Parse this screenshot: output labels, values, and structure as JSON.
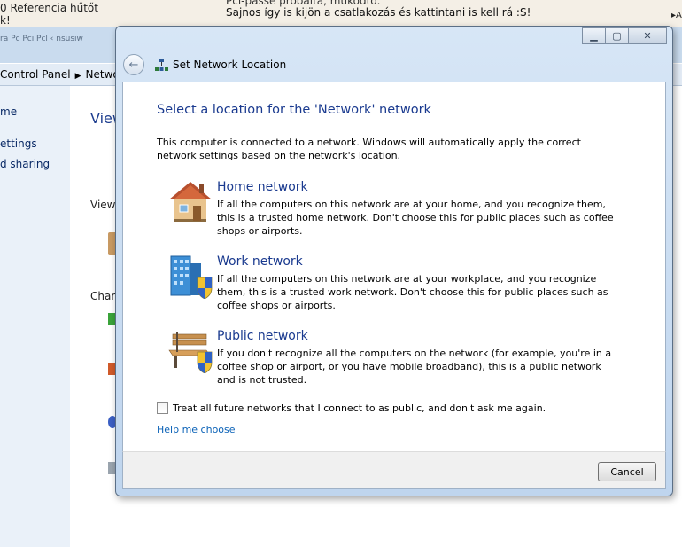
{
  "forum": {
    "left_line1": "0 Referencia hűtőt",
    "left_line2": "k!",
    "post_top": "Pci-passe próbáltá, működtő.",
    "post_line": "Sajnos így is kijön a csatlakozás és kattintani is kell rá :S!",
    "right_text": "Al"
  },
  "control_panel": {
    "title_text": "ra Pc Pci Pcl  ‹ nsusiw",
    "breadcrumb": [
      "Control Panel",
      "Network"
    ],
    "sidebar_items": [
      "me",
      "ettings",
      "d sharing"
    ],
    "main_heading": "View",
    "view_label": "View",
    "change_label": "Chan"
  },
  "dialog": {
    "title": "Set Network Location",
    "heading": "Select a location for the 'Network' network",
    "intro": "This computer is connected to a network. Windows will automatically apply the correct network settings based on the network's location.",
    "options": [
      {
        "title": "Home network",
        "description": "If all the computers on this network are at your home, and you recognize them, this is a trusted home network.  Don't choose this for public places such as coffee shops or airports.",
        "icon": "house-icon"
      },
      {
        "title": "Work network",
        "description": "If all the computers on this network are at your workplace, and you recognize them, this is a trusted work network.  Don't choose this for public places such as coffee shops or airports.",
        "icon": "office-building-icon"
      },
      {
        "title": "Public network",
        "description": "If you don't recognize all the computers on the network (for example, you're in a coffee shop or airport, or you have mobile broadband), this is a public network and is not trusted.",
        "icon": "park-bench-icon"
      }
    ],
    "checkbox_label": "Treat all future networks that I connect to as public, and don't ask me again.",
    "checkbox_checked": false,
    "help_link": "Help me choose",
    "cancel_label": "Cancel"
  },
  "colors": {
    "heading_blue": "#1a3a8f",
    "link_blue": "#0b62b7",
    "frame_blue": "#bfd5ee"
  }
}
